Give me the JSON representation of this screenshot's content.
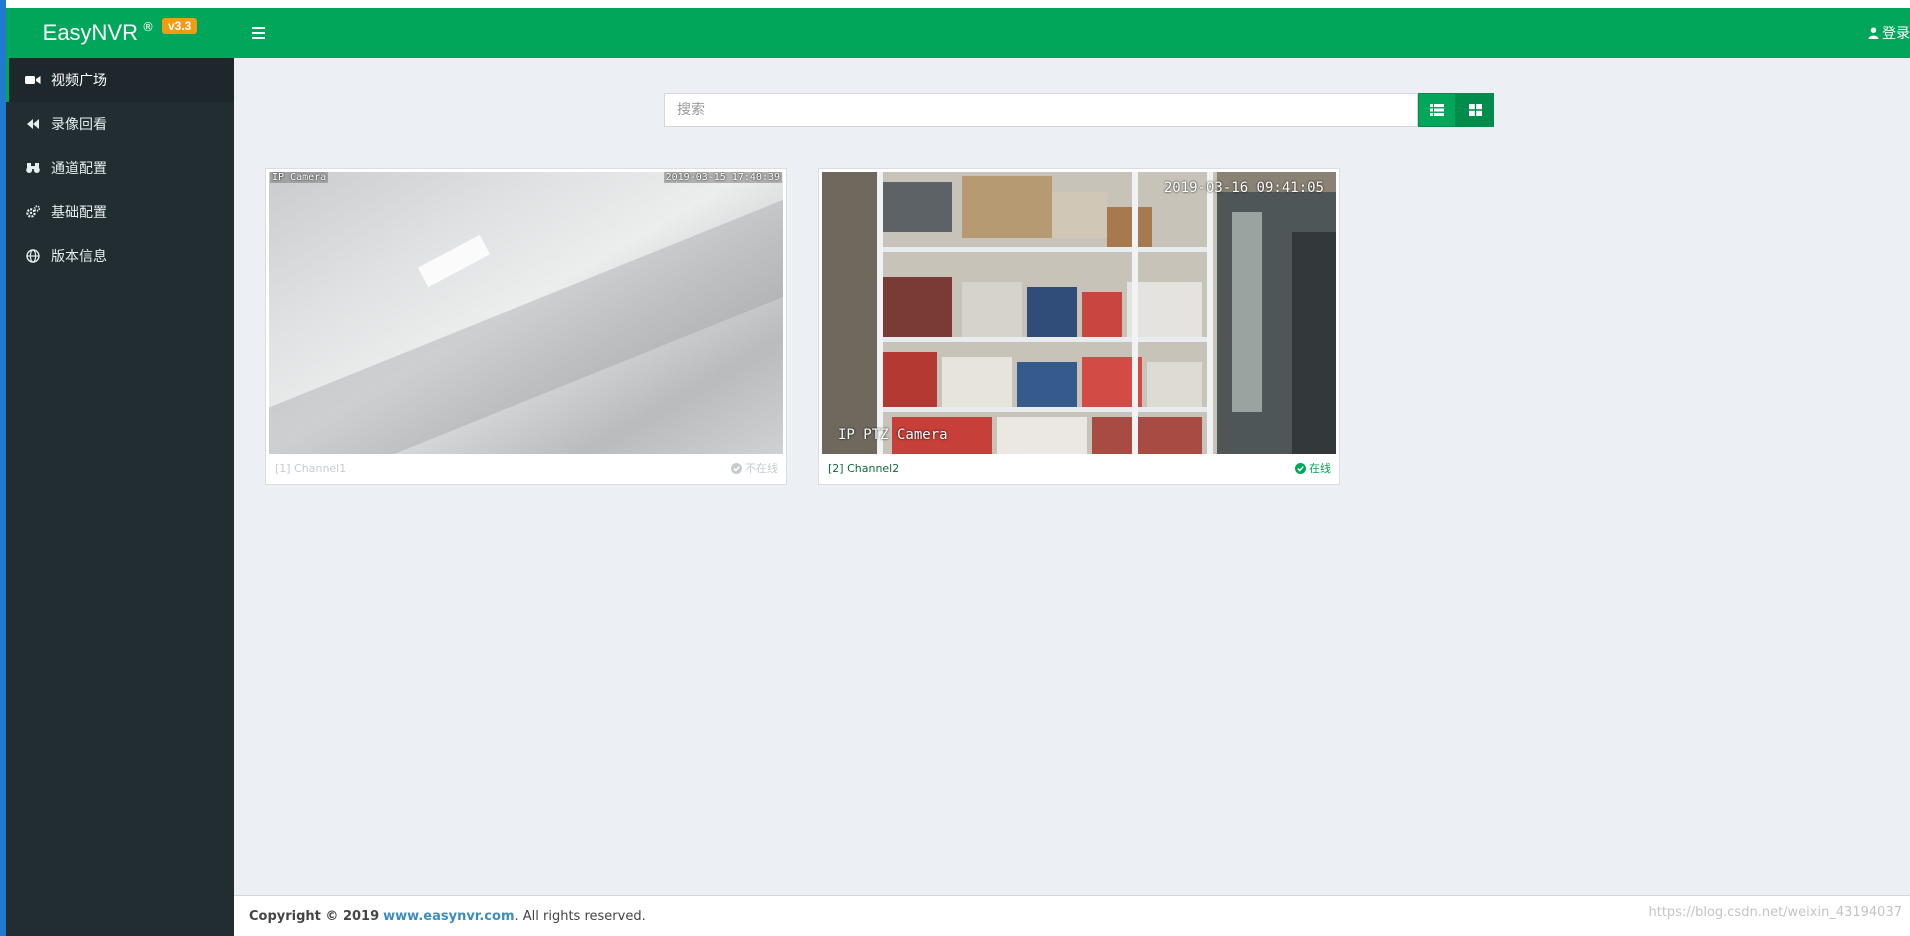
{
  "header": {
    "brand": "EasyNVR",
    "registered": "®",
    "version": "v3.3",
    "login_label": "登录"
  },
  "sidebar": {
    "items": [
      {
        "label": "视频广场",
        "icon": "video-camera-icon",
        "active": true
      },
      {
        "label": "录像回看",
        "icon": "backward-icon",
        "active": false
      },
      {
        "label": "通道配置",
        "icon": "binoculars-icon",
        "active": false
      },
      {
        "label": "基础配置",
        "icon": "cogs-icon",
        "active": false
      },
      {
        "label": "版本信息",
        "icon": "globe-icon",
        "active": false
      }
    ]
  },
  "search": {
    "placeholder": "搜索",
    "value": ""
  },
  "view_toggle": {
    "list_icon": "list-icon",
    "grid_icon": "grid-icon",
    "active": "grid"
  },
  "channels": [
    {
      "title": "[1] Channel1",
      "status": "不在线",
      "online": false,
      "osd_label": "IP Camera",
      "osd_time": "2019-03-15 17:40:39"
    },
    {
      "title": "[2] Channel2",
      "status": "在线",
      "online": true,
      "osd_label": "IP PTZ Camera",
      "osd_time": "2019-03-16 09:41:05"
    }
  ],
  "footer": {
    "copyright": "Copyright © 2019",
    "link_text": "www.easynvr.com",
    "suffix": ". All rights reserved."
  },
  "watermark": "https://blog.csdn.net/weixin_43194037",
  "colors": {
    "brand_green": "#00a65a",
    "sidebar_bg": "#222d32",
    "version_badge": "#f39c12",
    "content_bg": "#ecf0f5",
    "link_blue": "#3c8dbc"
  }
}
